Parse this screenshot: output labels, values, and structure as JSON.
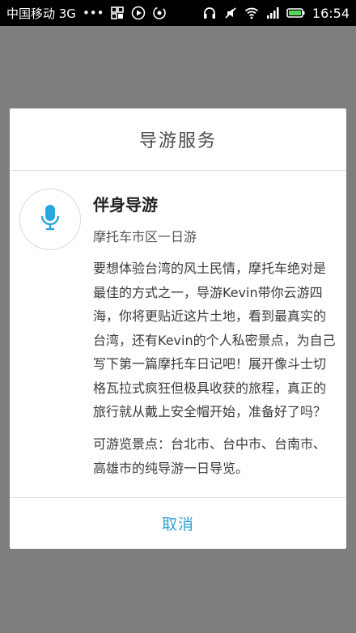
{
  "status_bar": {
    "carrier": "中国移动 3G",
    "dots": "•••",
    "time": "16:54",
    "icons": [
      "grid-icon",
      "play-icon",
      "sync-icon",
      "headphones-icon",
      "mute-icon",
      "wifi-icon",
      "signal-icon",
      "battery-icon"
    ]
  },
  "dialog": {
    "title": "导游服务",
    "guide": {
      "icon": "microphone-icon",
      "name": "伴身导游",
      "tour": "摩托车市区一日游",
      "description": "要想体验台湾的风土民情，摩托车绝对是最佳的方式之一，导游Kevin带你云游四海，你将更贴近这片土地，看到最真实的台湾，还有Kevin的个人私密景点，为自己写下第一篇摩托车日记吧！展开像斗士切 格瓦拉式疯狂但极具收获的旅程，真正的旅行就从戴上安全帽开始，准备好了吗？",
      "spots": "可游览景点：台北市、台中市、台南市、高雄市的纯导游一日导览。"
    },
    "cancel_label": "取消"
  },
  "colors": {
    "accent": "#2aa3d6",
    "mic_icon": "#29a6df",
    "overlay": "#7e7e7e"
  }
}
